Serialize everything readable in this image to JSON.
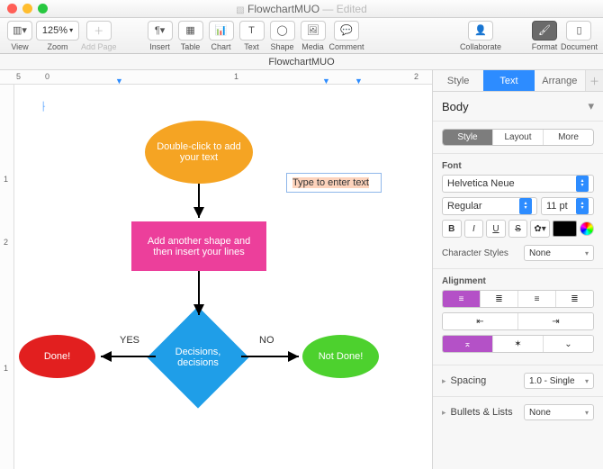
{
  "title": {
    "doc_name": "FlowchartMUO",
    "status": "Edited"
  },
  "toolbar": {
    "view": "View",
    "zoom_value": "125%",
    "zoom": "Zoom",
    "add_page": "Add Page",
    "insert": "Insert",
    "table": "Table",
    "chart": "Chart",
    "text": "Text",
    "shape": "Shape",
    "media": "Media",
    "comment": "Comment",
    "collaborate": "Collaborate",
    "format": "Format",
    "document": "Document"
  },
  "subtitle": "FlowchartMUO",
  "ruler_h": [
    "5",
    "0",
    "1",
    "2"
  ],
  "ruler_v": [
    "1",
    "2",
    "1"
  ],
  "canvas": {
    "shape1": "Double-click to add your text",
    "shape2": "Add another shape and then insert your lines",
    "shape3": "Decisions, decisions",
    "done": "Done!",
    "notdone": "Not Done!",
    "textbox": "Type to enter text",
    "yes": "YES",
    "no": "NO"
  },
  "inspector": {
    "tabs": {
      "style": "Style",
      "text": "Text",
      "arrange": "Arrange"
    },
    "bodylabel": "Body",
    "seg": {
      "style": "Style",
      "layout": "Layout",
      "more": "More"
    },
    "font_label": "Font",
    "font_family": "Helvetica Neue",
    "font_weight": "Regular",
    "font_size": "11 pt",
    "b": "B",
    "i": "I",
    "u": "U",
    "s": "S",
    "char_styles_label": "Character Styles",
    "char_styles_value": "None",
    "alignment_label": "Alignment",
    "spacing_label": "Spacing",
    "spacing_value": "1.0 - Single",
    "bullets_label": "Bullets & Lists",
    "bullets_value": "None"
  }
}
